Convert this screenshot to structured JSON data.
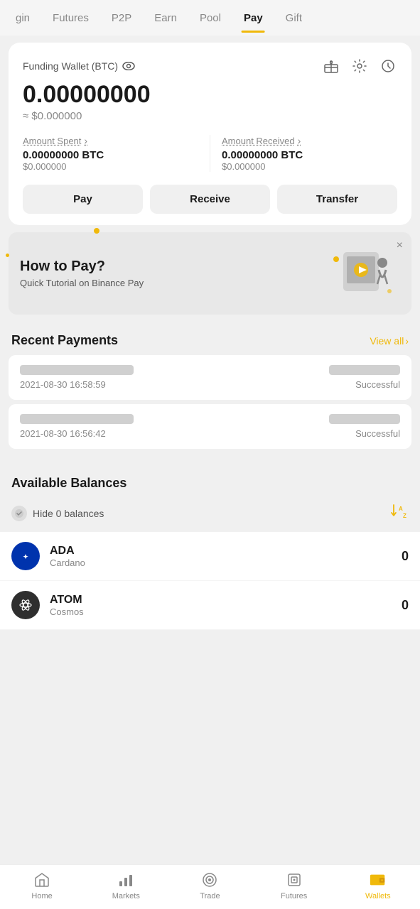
{
  "nav": {
    "items": [
      {
        "id": "margin",
        "label": "gin",
        "active": false
      },
      {
        "id": "futures",
        "label": "Futures",
        "active": false
      },
      {
        "id": "p2p",
        "label": "P2P",
        "active": false
      },
      {
        "id": "earn",
        "label": "Earn",
        "active": false
      },
      {
        "id": "pool",
        "label": "Pool",
        "active": false
      },
      {
        "id": "pay",
        "label": "Pay",
        "active": true
      },
      {
        "id": "gift",
        "label": "Gift",
        "active": false
      }
    ]
  },
  "wallet": {
    "title": "Funding Wallet (BTC)",
    "balance": "0.00000000",
    "balance_usd": "≈ $0.000000",
    "amount_spent_label": "Amount Spent",
    "amount_spent_btc": "0.00000000 BTC",
    "amount_spent_usd": "$0.000000",
    "amount_received_label": "Amount Received",
    "amount_received_btc": "0.00000000 BTC",
    "amount_received_usd": "$0.000000",
    "pay_btn": "Pay",
    "receive_btn": "Receive",
    "transfer_btn": "Transfer"
  },
  "banner": {
    "title": "How to Pay?",
    "subtitle": "Quick Tutorial on Binance Pay",
    "close": "×"
  },
  "recent_payments": {
    "section_title": "Recent Payments",
    "view_all": "View all",
    "items": [
      {
        "date": "2021-08-30 16:58:59",
        "status": "Successful"
      },
      {
        "date": "2021-08-30 16:56:42",
        "status": "Successful"
      }
    ]
  },
  "available_balances": {
    "section_title": "Available Balances",
    "hide_zero_label": "Hide 0 balances",
    "coins": [
      {
        "symbol": "ADA",
        "name": "Cardano",
        "balance": "0",
        "icon_class": "ada"
      },
      {
        "symbol": "ATOM",
        "name": "Cosmos",
        "balance": "0",
        "icon_class": "atom"
      }
    ]
  },
  "bottom_nav": {
    "items": [
      {
        "id": "home",
        "label": "Home",
        "icon": "home",
        "active": false
      },
      {
        "id": "markets",
        "label": "Markets",
        "icon": "markets",
        "active": false
      },
      {
        "id": "trade",
        "label": "Trade",
        "icon": "trade",
        "active": false
      },
      {
        "id": "futures",
        "label": "Futures",
        "icon": "futures",
        "active": false
      },
      {
        "id": "wallets",
        "label": "Wallets",
        "icon": "wallets",
        "active": true
      }
    ]
  }
}
